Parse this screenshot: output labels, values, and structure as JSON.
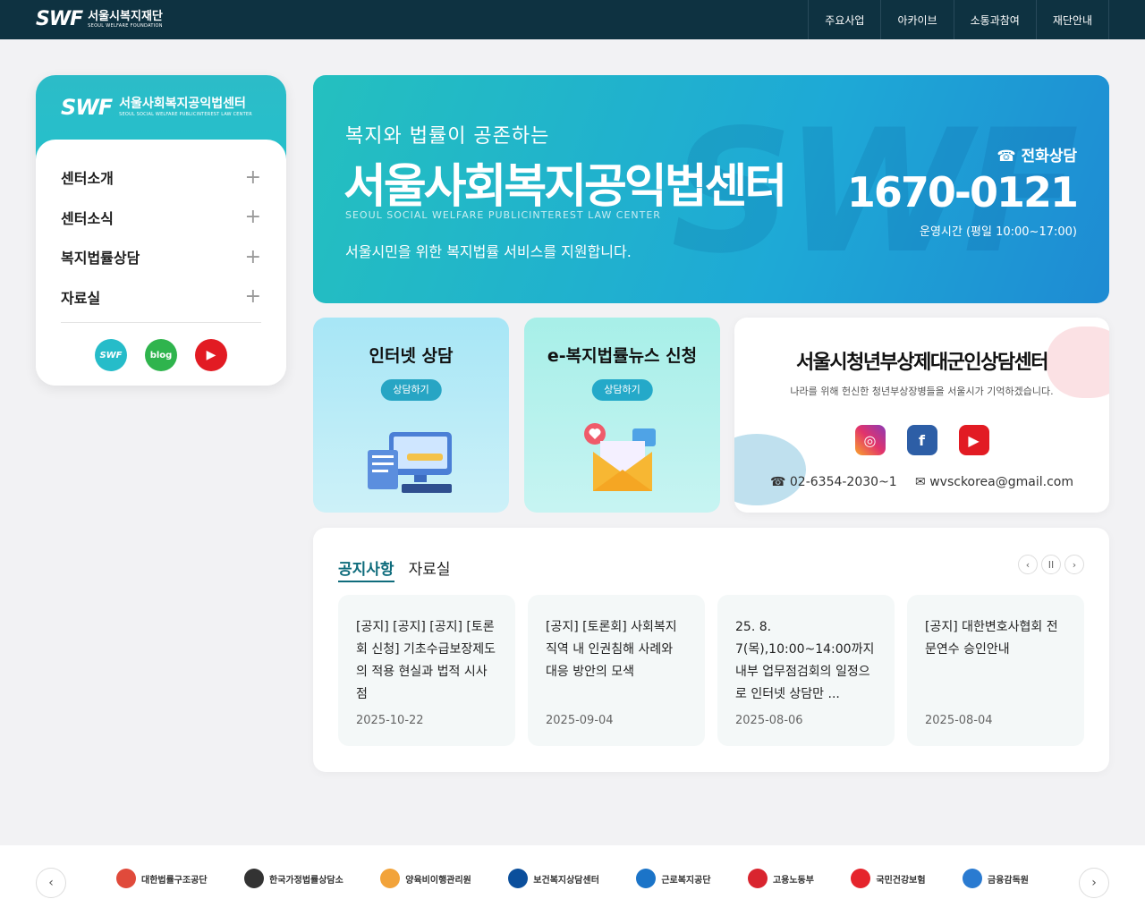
{
  "topbar": {
    "logo_mark": "SWF",
    "logo_ko": "서울시복지재단",
    "logo_en": "SEOUL WELFARE FOUNDATION",
    "nav": [
      "주요사업",
      "아카이브",
      "소통과참여",
      "재단안내"
    ]
  },
  "sidebar": {
    "logo_mark": "SWF",
    "logo_ko": "서울사회복지공익법센터",
    "logo_en": "SEOUL SOCIAL WELFARE PUBLICINTEREST LAW CENTER",
    "items": [
      {
        "label": "센터소개",
        "icon": "+"
      },
      {
        "label": "센터소식",
        "icon": "+"
      },
      {
        "label": "복지법률상담",
        "icon": "+"
      },
      {
        "label": "자료실",
        "icon": "+"
      }
    ],
    "social": {
      "swf": "SWF",
      "blog": "blog",
      "youtube": "▶"
    }
  },
  "banner": {
    "subtitle": "복지와 법률이 공존하는",
    "title": "서울사회복지공익법센터",
    "english": "SEOUL SOCIAL WELFARE PUBLICINTEREST LAW CENTER",
    "description": "서울시민을 위한 복지법률 서비스를 지원합니다.",
    "tel_label": "☎ 전화상담",
    "tel_number": "1670-0121",
    "tel_hours": "운영시간 (평일 10:00~17:00)"
  },
  "cards": {
    "internet": {
      "title": "인터넷 상담",
      "button": "상담하기"
    },
    "news": {
      "title": "e-복지법률뉴스 신청",
      "button": "상담하기"
    },
    "veteran": {
      "title": "서울시청년부상제대군인상담센터",
      "subtitle": "나라를 위해 헌신한 청년부상장병들을 서울시가 기억하겠습니다.",
      "phone": "☎ 02-6354-2030~1",
      "email": "✉ wvsckorea@gmail.com"
    }
  },
  "notice": {
    "tabs": [
      "공지사항",
      "자료실"
    ],
    "controls": {
      "prev": "‹",
      "pause": "II",
      "next": "›"
    },
    "posts": [
      {
        "title": "[공지] [공지] [공지] [토론회 신청] 기초수급보장제도의 적용 현실과 법적 시사점",
        "date": "2025-10-22"
      },
      {
        "title": "[공지] [토론회] 사회복지 직역 내 인권침해 사례와 대응 방안의 모색",
        "date": "2025-09-04"
      },
      {
        "title": "25. 8. 7(목),10:00~14:00까지 내부 업무점검회의 일정으로 인터넷 상담만 ...",
        "date": "2025-08-06"
      },
      {
        "title": "[공지] 대한변호사협회 전문연수 승인안내",
        "date": "2025-08-04"
      }
    ]
  },
  "footer": {
    "prev": "‹",
    "next": "›",
    "partners": [
      "대한법률구조공단",
      "한국가정법률상담소",
      "양육비이행관리원",
      "보건복지상담센터",
      "근로복지공단",
      "고용노동부",
      "국민건강보험",
      "금융감독원"
    ],
    "partner_colors": [
      "#e04a3b",
      "#333333",
      "#f2a33a",
      "#0b4f9c",
      "#1b74c8",
      "#d9252f",
      "#e5242c",
      "#2a7bd1"
    ]
  }
}
